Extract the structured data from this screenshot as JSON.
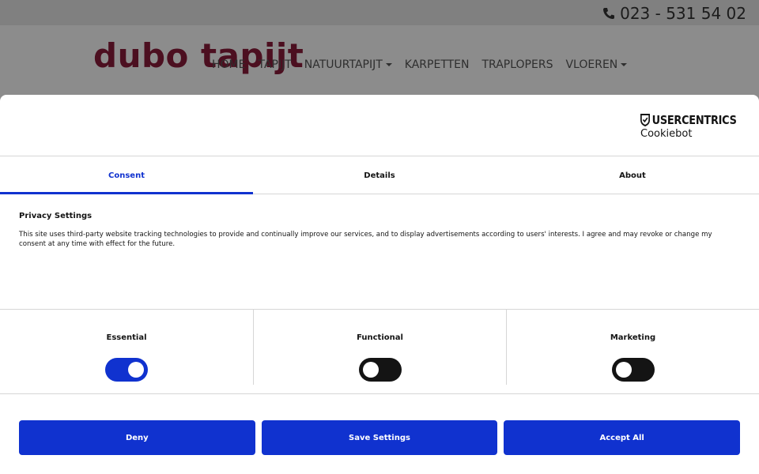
{
  "site": {
    "phone": "023 - 531 54 02",
    "logo": "dubo tapijt",
    "nav": [
      {
        "label": "HOME",
        "dropdown": false
      },
      {
        "label": "TAPIJT",
        "dropdown": false
      },
      {
        "label": "NATUURTAPIJT",
        "dropdown": true
      },
      {
        "label": "KARPETTEN",
        "dropdown": false
      },
      {
        "label": "TRAPLOPERS",
        "dropdown": false
      },
      {
        "label": "VLOEREN",
        "dropdown": true
      }
    ]
  },
  "dialog": {
    "brand": {
      "name": "USERCENTRICS",
      "product": "Cookiebot"
    },
    "tabs": [
      {
        "label": "Consent",
        "active": true
      },
      {
        "label": "Details",
        "active": false
      },
      {
        "label": "About",
        "active": false
      }
    ],
    "title": "Privacy Settings",
    "text": "This site uses third-party website tracking technologies to provide and continually improve our services, and to display advertisements according to users' interests. I agree and may revoke or change my consent at any time with effect for the future.",
    "toggles": [
      {
        "label": "Essential",
        "on": true
      },
      {
        "label": "Functional",
        "on": false
      },
      {
        "label": "Marketing",
        "on": false
      }
    ],
    "buttons": {
      "deny": "Deny",
      "save": "Save Settings",
      "accept": "Accept All"
    }
  },
  "colors": {
    "accent": "#1032cf",
    "logo": "#8b1c3b",
    "text": "#141414"
  }
}
